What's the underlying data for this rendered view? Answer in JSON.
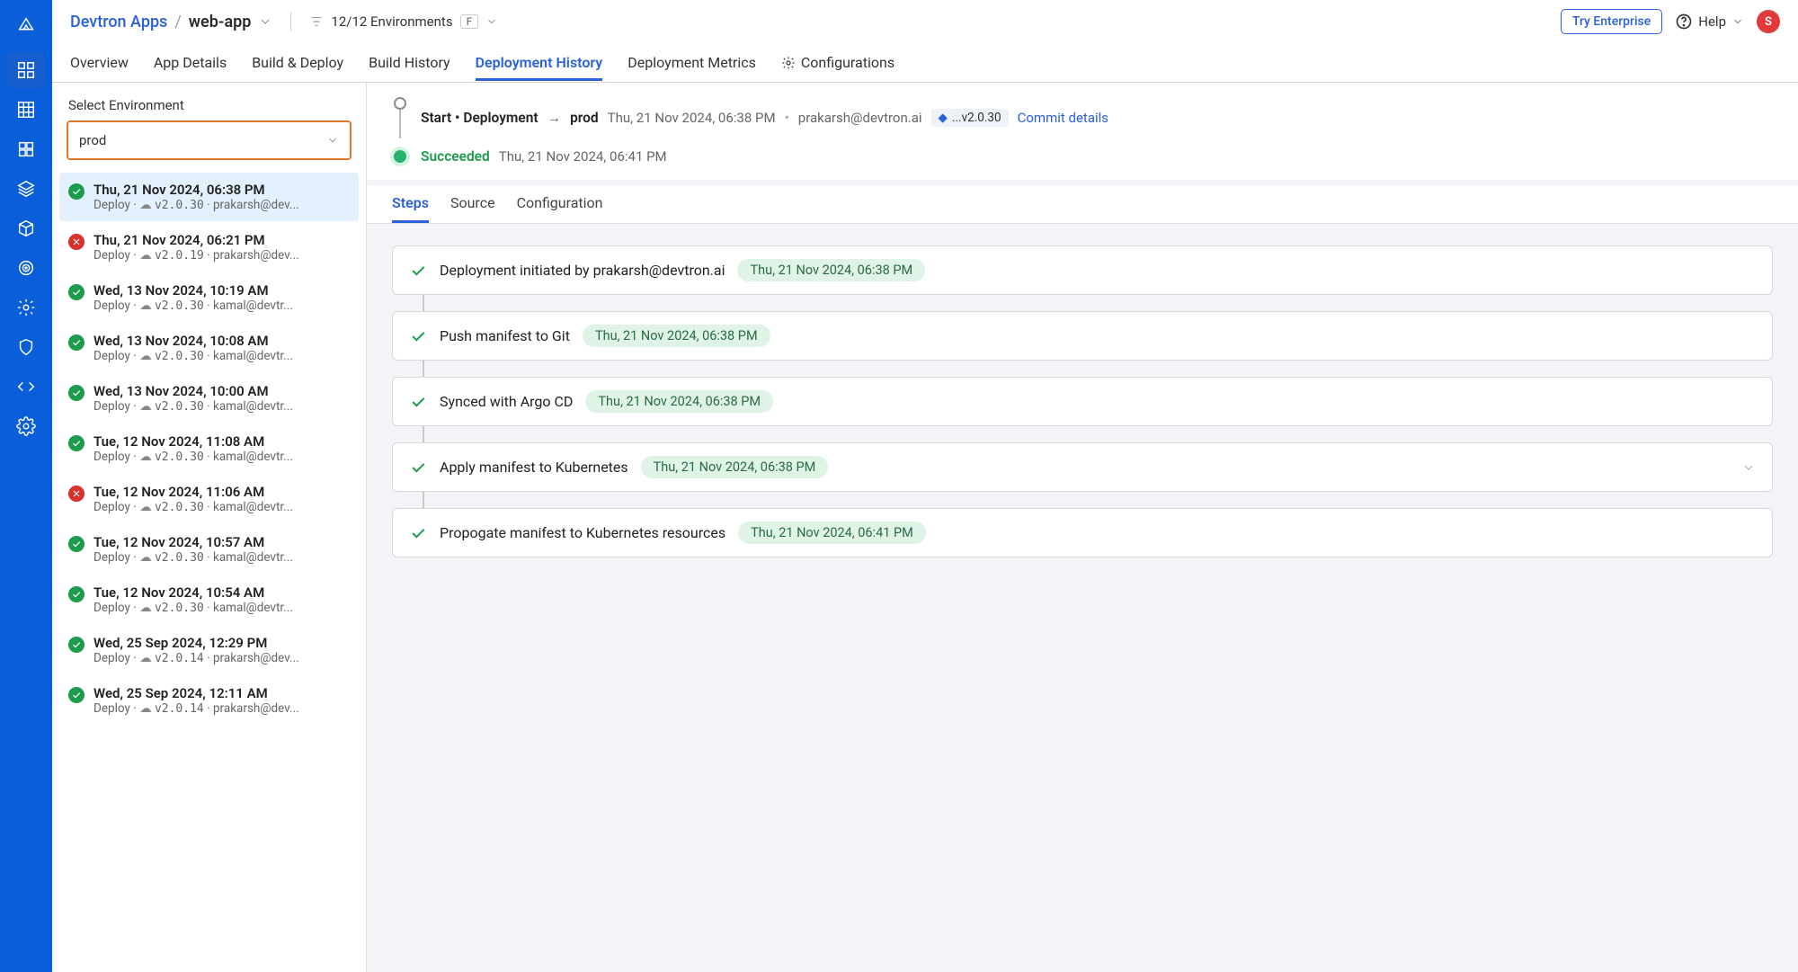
{
  "breadcrumb": {
    "org": "Devtron Apps",
    "app": "web-app"
  },
  "env_filter": {
    "label": "12/12 Environments",
    "key": "F"
  },
  "top_actions": {
    "try": "Try Enterprise",
    "help": "Help",
    "avatar": "S"
  },
  "tabs": [
    "Overview",
    "App Details",
    "Build & Deploy",
    "Build History",
    "Deployment History",
    "Deployment Metrics",
    "Configurations"
  ],
  "active_tab": 4,
  "sidebar": {
    "label": "Select Environment",
    "selected_env": "prod"
  },
  "history": [
    {
      "status": "ok",
      "date": "Thu, 21 Nov 2024, 06:38 PM",
      "action": "Deploy",
      "version": "v2.0.30",
      "user": "prakarsh@dev...",
      "selected": true
    },
    {
      "status": "fail",
      "date": "Thu, 21 Nov 2024, 06:21 PM",
      "action": "Deploy",
      "version": "v2.0.19",
      "user": "prakarsh@dev..."
    },
    {
      "status": "ok",
      "date": "Wed, 13 Nov 2024, 10:19 AM",
      "action": "Deploy",
      "version": "v2.0.30",
      "user": "kamal@devtr..."
    },
    {
      "status": "ok",
      "date": "Wed, 13 Nov 2024, 10:08 AM",
      "action": "Deploy",
      "version": "v2.0.30",
      "user": "kamal@devtr..."
    },
    {
      "status": "ok",
      "date": "Wed, 13 Nov 2024, 10:00 AM",
      "action": "Deploy",
      "version": "v2.0.30",
      "user": "kamal@devtr..."
    },
    {
      "status": "ok",
      "date": "Tue, 12 Nov 2024, 11:08 AM",
      "action": "Deploy",
      "version": "v2.0.30",
      "user": "kamal@devtr..."
    },
    {
      "status": "fail",
      "date": "Tue, 12 Nov 2024, 11:06 AM",
      "action": "Deploy",
      "version": "v2.0.30",
      "user": "kamal@devtr..."
    },
    {
      "status": "ok",
      "date": "Tue, 12 Nov 2024, 10:57 AM",
      "action": "Deploy",
      "version": "v2.0.30",
      "user": "kamal@devtr..."
    },
    {
      "status": "ok",
      "date": "Tue, 12 Nov 2024, 10:54 AM",
      "action": "Deploy",
      "version": "v2.0.30",
      "user": "kamal@devtr..."
    },
    {
      "status": "ok",
      "date": "Wed, 25 Sep 2024, 12:29 PM",
      "action": "Deploy",
      "version": "v2.0.14",
      "user": "prakarsh@dev..."
    },
    {
      "status": "ok",
      "date": "Wed, 25 Sep 2024, 12:11 AM",
      "action": "Deploy",
      "version": "v2.0.14",
      "user": "prakarsh@dev..."
    }
  ],
  "timeline": {
    "start_label": "Start • Deployment",
    "target": "prod",
    "start_ts": "Thu, 21 Nov 2024, 06:38 PM",
    "start_user": "prakarsh@devtron.ai",
    "tag": "...v2.0.30",
    "commit_link": "Commit details",
    "end_status": "Succeeded",
    "end_ts": "Thu, 21 Nov 2024, 06:41 PM"
  },
  "subtabs": [
    "Steps",
    "Source",
    "Configuration"
  ],
  "active_subtab": 0,
  "steps": [
    {
      "title": "Deployment initiated by prakarsh@devtron.ai",
      "ts": "Thu, 21 Nov 2024, 06:38 PM"
    },
    {
      "title": "Push manifest to Git",
      "ts": "Thu, 21 Nov 2024, 06:38 PM"
    },
    {
      "title": "Synced with Argo CD",
      "ts": "Thu, 21 Nov 2024, 06:38 PM"
    },
    {
      "title": "Apply manifest to Kubernetes",
      "ts": "Thu, 21 Nov 2024, 06:38 PM",
      "expandable": true
    },
    {
      "title": "Propogate manifest to Kubernetes resources",
      "ts": "Thu, 21 Nov 2024, 06:41 PM"
    }
  ]
}
